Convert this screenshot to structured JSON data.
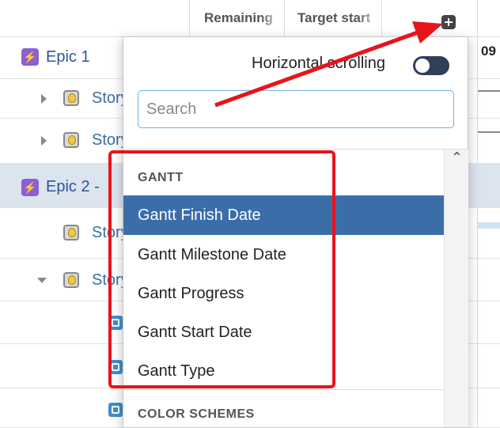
{
  "columns": {
    "remaining": "Remaining",
    "target_start": "Target start",
    "date_header": "09"
  },
  "rows": [
    {
      "type": "epic",
      "label": "Epic 1"
    },
    {
      "type": "story",
      "label": "Story"
    },
    {
      "type": "story",
      "label": "Story"
    },
    {
      "type": "epic",
      "label": "Epic 2 -"
    },
    {
      "type": "story",
      "label": "Story"
    },
    {
      "type": "story",
      "label": "Story"
    }
  ],
  "popup": {
    "horizontal_scrolling_label": "Horizontal scrolling",
    "horizontal_scrolling_on": false,
    "search_placeholder": "Search",
    "groups": [
      {
        "header": "GANTT",
        "items": [
          "Gantt Finish Date",
          "Gantt Milestone Date",
          "Gantt Progress",
          "Gantt Start Date",
          "Gantt Type"
        ],
        "selected": "Gantt Finish Date"
      },
      {
        "header": "COLOR SCHEMES",
        "items": []
      }
    ]
  },
  "icons": {
    "epic": "lightning-icon",
    "story": "lightbulb-icon",
    "subtask": "subtask-icon",
    "add_column": "plus-icon"
  },
  "colors": {
    "selected_item_bg": "#3b6ea8",
    "epic_icon": "#8b5fd6",
    "annotation_red": "#e8141b",
    "toggle_off": "#303f5a"
  }
}
